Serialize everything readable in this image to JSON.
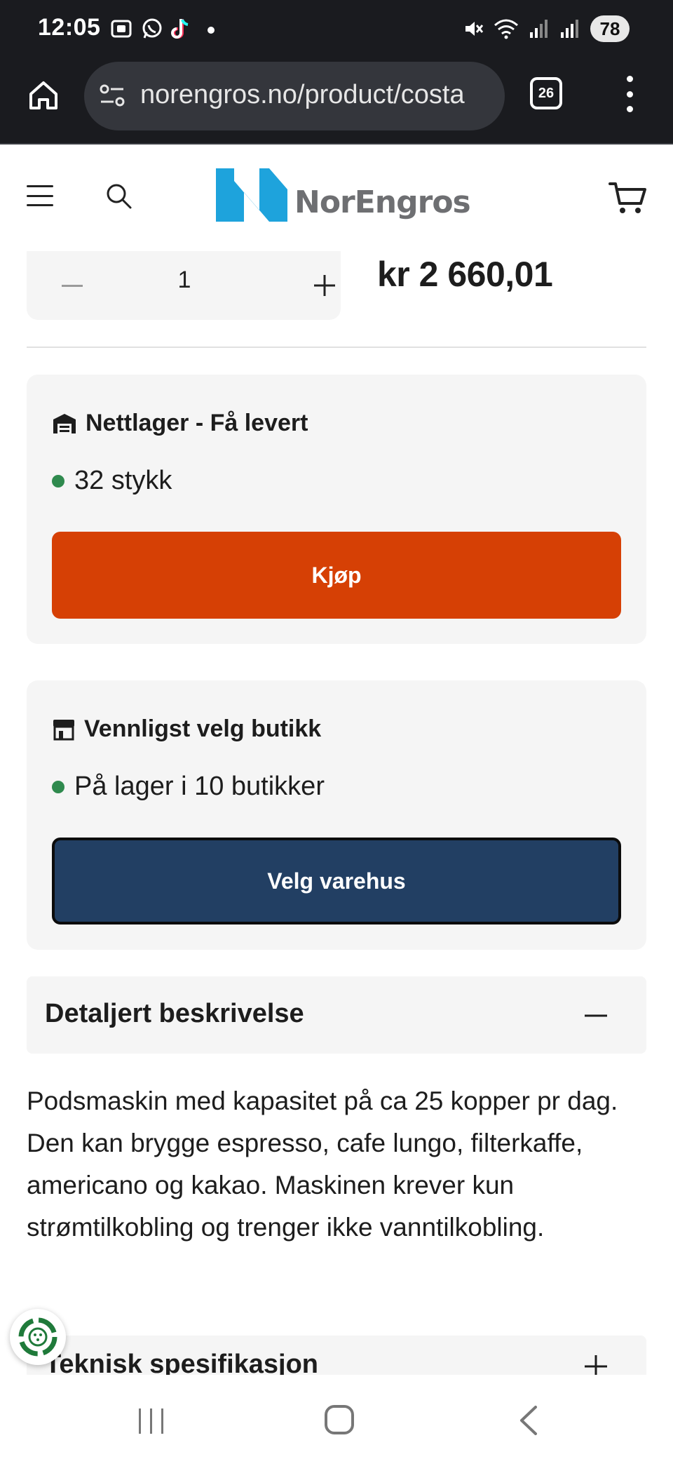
{
  "status_bar": {
    "time": "12:05",
    "battery": "78",
    "icons": [
      "screenshot-icon",
      "whatsapp-icon",
      "tiktok-icon",
      "mute-icon",
      "wifi-icon",
      "signal-icon",
      "signal-icon-2"
    ]
  },
  "browser": {
    "url": "norengros.no/product/costa",
    "tab_count": "26"
  },
  "site": {
    "logo_text": "NorEngros",
    "brand_color": "#1ea3dc"
  },
  "product": {
    "quantity": "1",
    "price": "kr 2 660,01"
  },
  "online_stock": {
    "title": "Nettlager - Få levert",
    "stock": "32 stykk",
    "buy_label": "Kjøp",
    "button_color": "#d64005"
  },
  "store_stock": {
    "title": "Vennligst velg butikk",
    "stock": "På lager i 10 butikker",
    "select_label": "Velg varehus",
    "button_color": "#223f63"
  },
  "details": {
    "title": "Detaljert beskrivelse",
    "description": "Podsmaskin med kapasitet på ca 25 kopper pr dag. Den kan brygge espresso, cafe lungo, filterkaffe, americano og kakao. Maskinen krever kun strømtilkobling og trenger ikke vanntilkobling."
  },
  "tech_spec": {
    "title": "Teknisk spesifikasjon"
  }
}
